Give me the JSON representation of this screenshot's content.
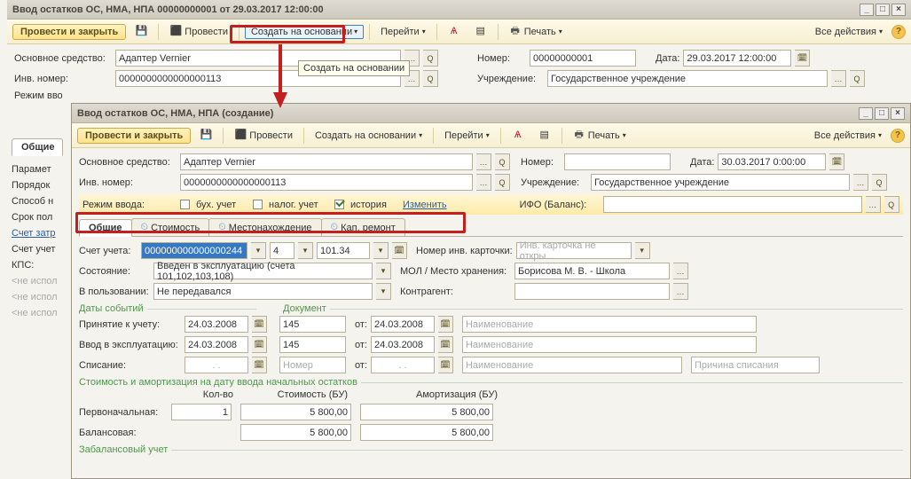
{
  "back": {
    "title": "Ввод остатков ОС, НМА, НПА 00000000001 от 29.03.2017 12:00:00",
    "toolbar": {
      "post_close": "Провести и закрыть",
      "post": "Провести",
      "create_on_basis": "Создать на основании",
      "go_to": "Перейти",
      "print": "Печать",
      "all_actions": "Все действия"
    },
    "fields": {
      "asset_lbl": "Основное средство:",
      "asset_val": "Адаптер Vernier",
      "number_lbl": "Номер:",
      "number_val": "00000000001",
      "date_lbl": "Дата:",
      "date_val": "29.03.2017 12:00:00",
      "inv_lbl": "Инв. номер:",
      "inv_val": "0000000000000000113",
      "uchr_lbl": "Учреждение:",
      "uchr_val": "Государственное учреждение",
      "mode_lbl": "Режим вво",
      "tooltip": "Создать на основании"
    },
    "side": {
      "tab_common": "Общие",
      "p1": "Парамет",
      "p2": "Порядок",
      "p3": "Способ н",
      "p4": "Срок пол",
      "p5": "Счет затр",
      "p6": "Счет учет",
      "p7": "КПС:",
      "p8": "<не испол",
      "p9": "<не испол",
      "p10": "<не испол"
    }
  },
  "front": {
    "title": "Ввод остатков ОС, НМА, НПА (создание)",
    "toolbar": {
      "post_close": "Провести и закрыть",
      "post": "Провести",
      "create_on_basis": "Создать на основании",
      "go_to": "Перейти",
      "print": "Печать",
      "all_actions": "Все действия"
    },
    "fields": {
      "asset_lbl": "Основное средство:",
      "asset_val": "Адаптер Vernier",
      "number_lbl": "Номер:",
      "date_lbl": "Дата:",
      "date_val": "30.03.2017 0:00:00",
      "inv_lbl": "Инв. номер:",
      "inv_val": "0000000000000000113",
      "uchr_lbl": "Учреждение:",
      "uchr_val": "Государственное учреждение",
      "mode_lbl": "Режим ввода:",
      "mode_buh": "бух. учет",
      "mode_nal": "налог. учет",
      "mode_hist": "история",
      "mode_change": "Изменить",
      "ifo_lbl": "ИФО (Баланс):"
    },
    "tabs": {
      "common": "Общие",
      "cost": "Стоимость",
      "location": "Местонахождение",
      "repair": "Кап. ремонт"
    },
    "common": {
      "acct_lbl": "Счет учета:",
      "acct_val": "000000000000000244",
      "acct2": "4",
      "acct3": "101.34",
      "card_lbl": "Номер инв. карточки:",
      "card_ph": "Инв. карточка не откры...",
      "state_lbl": "Состояние:",
      "state_val": "Введен в эксплуатацию (счета 101,102,103,108)",
      "mol_lbl": "МОЛ / Место хранения:",
      "mol_val": "Борисова М. В. - Школа",
      "owner_lbl": "В пользовании:",
      "owner_val": "Не передавался",
      "contr_lbl": "Контрагент:",
      "dates_hdr": "Даты событий",
      "doc_hdr": "Документ",
      "accept_lbl": "Принятие к учету:",
      "accept_date": "24.03.2008",
      "accept_num": "145",
      "ot": "от:",
      "accept_ot": "24.03.2008",
      "name_ph": "Наименование",
      "exp_lbl": "Ввод в эксплуатацию:",
      "exp_date": "24.03.2008",
      "exp_num": "145",
      "exp_ot": "24.03.2008",
      "writeoff_lbl": "Списание:",
      "num_ph": "Номер",
      "reason_ph": "Причина списания",
      "cost_hdr": "Стоимость и амортизация на дату ввода начальных остатков",
      "qty_hdr": "Кол-во",
      "cost_hdr2": "Стоимость (БУ)",
      "amort_hdr": "Амортизация (БУ)",
      "primary_lbl": "Первоначальная:",
      "qty_val": "1",
      "cost_val": "5 800,00",
      "amort_val": "5 800,00",
      "balance_lbl": "Балансовая:",
      "balance_cost": "5 800,00",
      "balance_amort": "5 800,00",
      "zab_lbl": "Забалансовый учет"
    }
  }
}
